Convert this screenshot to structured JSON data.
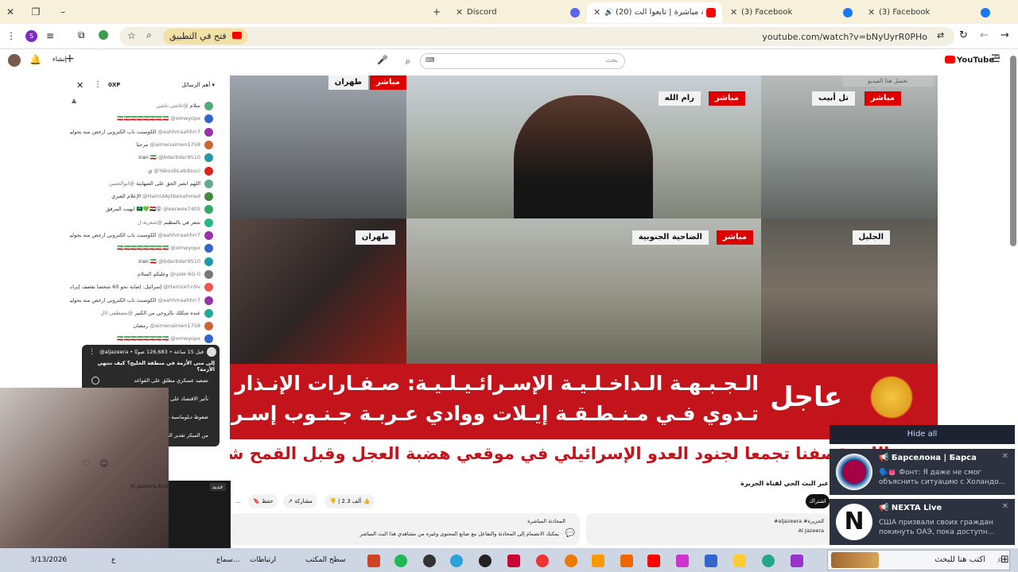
{
  "tabs": [
    {
      "label": "Discord"
    },
    {
      "label": "(20) تغطية مباشرة | تابعوا الت..."
    },
    {
      "label": "(3) Facebook"
    },
    {
      "label": "(3) Facebook"
    }
  ],
  "toolbar": {
    "open_app": "فتح في التطبيق",
    "url": "youtube.com/watch?v=bNyUyrR0PHo"
  },
  "youtube": {
    "logo": "YouTube",
    "logo_sup": "SA",
    "search_placeholder": "بحث",
    "create_label": "إنشاء"
  },
  "chat": {
    "header": "أهم الرسائل",
    "xp": "0XP",
    "messages": [
      {
        "user": "@عاشي-تاشي",
        "text": "سلام"
      },
      {
        "user": "@xmwyopx",
        "text": "🇮🇷🇮🇷🇮🇷🇮🇷🇮🇷🇮🇷🇮🇷🇮🇷"
      },
      {
        "user": "@aahhrraahhrr7",
        "text": "الكوسنت ناب الكتروني ارخص منه بحولين"
      },
      {
        "user": "@aimenaimen1758",
        "text": "مرحبا"
      },
      {
        "user": "@bderbder9510",
        "text": "Iran 🇮🇷"
      },
      {
        "user": "@YakoubLabdouci",
        "text": "ي"
      },
      {
        "user": "@ابوالحسن",
        "text": "اللهم انصر الحق على الصهاينة"
      },
      {
        "user": "@HamidAytbenahmed",
        "text": "الإعلام العبري"
      },
      {
        "user": "@eerwee7405",
        "text": "انهيت المرفق 🇸🇦💚🇪🇬😜"
      },
      {
        "user": "@شعرية-ل",
        "text": "شعر في بالمظيم"
      },
      {
        "user": "@aahhrraahhrr7",
        "text": "الكوسنت ناب الكتروني ارخص منه بحولين"
      },
      {
        "user": "@xmwyopx",
        "text": "🇮🇷🇮🇷🇮🇷🇮🇷🇮🇷🇮🇷🇮🇷🇮🇷"
      },
      {
        "user": "@bderbder9510",
        "text": "Iran 🇮🇷"
      },
      {
        "user": "@user-6G-0",
        "text": "وعليكم السلام"
      },
      {
        "user": "@HamzaY-n9v",
        "text": "إسرائيل: إصابة نحو 60 شخصا بقصف إيراني"
      },
      {
        "user": "@aahhrraahhrr7",
        "text": "الكوسنت ناب الكتروني ارخص منه بحولين"
      },
      {
        "user": "@مصطفى-لال",
        "text": "عنده شكلك بالروحي من الكبير"
      },
      {
        "user": "@aimenaimen1758",
        "text": "رمضان"
      },
      {
        "user": "@xmwyopx",
        "text": "🇮🇷🇮🇷🇮🇷🇮🇷🇮🇷🇮🇷🇮🇷🇮🇷"
      }
    ]
  },
  "poll": {
    "channel": "@aljazeera",
    "meta": "قبل 15 ساعة • 126,683 صوتًا",
    "question": "إلى متى الأزمة في منطقة الخليج؟ كيف تنتهي الأزمة؟",
    "options": [
      "تصعيد عسكري مطلق على القواعد",
      "تأثير الاقتصاد على المنطقة",
      "ضغوط دبلوماسية على القوى الإقليمية",
      "من المبكر تقدير النتائج"
    ]
  },
  "video": {
    "cells": [
      {
        "live": "مباشر",
        "city": "طهران"
      },
      {
        "live": "مباشر",
        "city": "رام الله"
      },
      {
        "live": "مباشر",
        "city": "تل أبيب"
      },
      {
        "live": "",
        "city": "طهران"
      },
      {
        "live": "مباشر",
        "city": "الضاحية الجنوبية"
      },
      {
        "live": "",
        "city": "الجليل"
      }
    ],
    "overlay_btn": "تحميل هذا الفيديو",
    "breaking_label": "عاجل",
    "breaking_line1": "الـجـبـهـة الـداخـلـيـة الإسـرائـيـلـيـة: صـفـارات الإنـذار",
    "breaking_line2": "تـدوي فـي مـنـطـقـة إيـلات ووادي عـربـة جـنـوب إسـرائـيـل",
    "ticker": "حزب الله: قصفنا تجمعا لجنود العدو الإسرائيلي في موقعي هضبة العجل وقبل القمح شمالي"
  },
  "below": {
    "title": "عبر البث الحي لقناة الجزيرة",
    "subscribe": "اشتراك",
    "likes": "2.3 ألف",
    "share": "مشاركة",
    "save": "حفظ",
    "more": "...",
    "desc_title": "المحادثة المباشرة",
    "desc_text": "يمكنك الانضمام إلى المحادثة والتفاعل مع صانع المحتوى وغيره من مشاهدي هذا البث المباشر",
    "desc2_tag": "#aljazeera #الجزيرة",
    "desc2_sub": "Al Jazeera",
    "channel": "Al Jazeera Arabic"
  },
  "notifications": {
    "hide_all": "Hide all",
    "items": [
      {
        "title": "📢 Барселона | Барса",
        "body": "🗣️👅 Фонт: Я даже не смог объяснить ситуацию с Холандо..."
      },
      {
        "title": "📢 NEXTA Live",
        "body": "США призвали своих граждан покинуть ОАЭ, пока доступн..."
      }
    ]
  },
  "taskbar": {
    "search": "اكتب هنا للبحث",
    "desktop": "سطح المكتب",
    "links": "ارتباطات",
    "music": "سماع...",
    "date": "3/13/2026",
    "lang": "ع"
  }
}
